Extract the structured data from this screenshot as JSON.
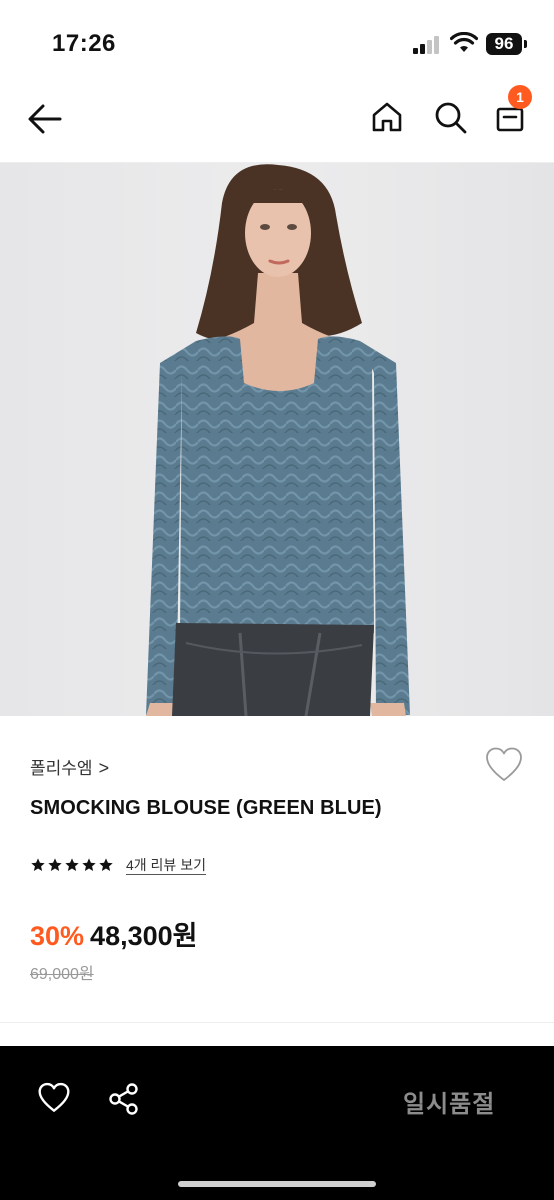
{
  "status_bar": {
    "time": "17:26",
    "battery": "96"
  },
  "header": {
    "cart_count": "1"
  },
  "icons": {
    "back": "arrow-left-icon",
    "home": "home-icon",
    "search": "search-icon",
    "cart": "shopping-bag-icon",
    "wishlist": "heart-outline-icon",
    "share": "share-icon",
    "star": "star-filled-icon"
  },
  "product": {
    "image_alt": "model wearing smocking blouse",
    "brand": "폴리수엠",
    "brand_chevron": ">",
    "name": "SMOCKING BLOUSE (GREEN BLUE)",
    "rating": {
      "stars": 5,
      "review_link": "4개 리뷰 보기"
    },
    "discount": "30%",
    "sale_price": "48,300원",
    "original_price": "69,000원"
  },
  "bottom_bar": {
    "soldout_label": "일시품절"
  },
  "colors": {
    "accent": "#ff5a1f",
    "bottom_bar": "#000000",
    "soldout_text": "#8c8c8c"
  }
}
